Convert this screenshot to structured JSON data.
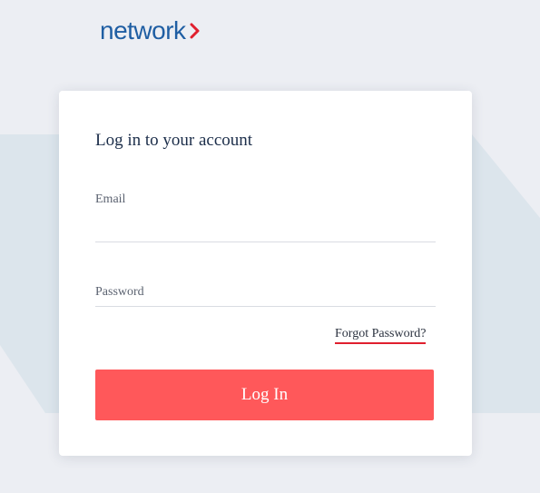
{
  "brand": {
    "logo_text": "network",
    "logo_chevron": "›",
    "logo_color": "#1f5ea3",
    "chevron_color": "#e0202e"
  },
  "login": {
    "title": "Log in to your account",
    "email_label": "Email",
    "email_value": "",
    "password_label": "Password",
    "password_value": "",
    "forgot_link": "Forgot Password?",
    "submit_label": "Log In"
  },
  "colors": {
    "background": "#eceef3",
    "background_shape": "#dce5ec",
    "card": "#ffffff",
    "button": "#ff585a",
    "accent_underline": "#e0202e"
  }
}
